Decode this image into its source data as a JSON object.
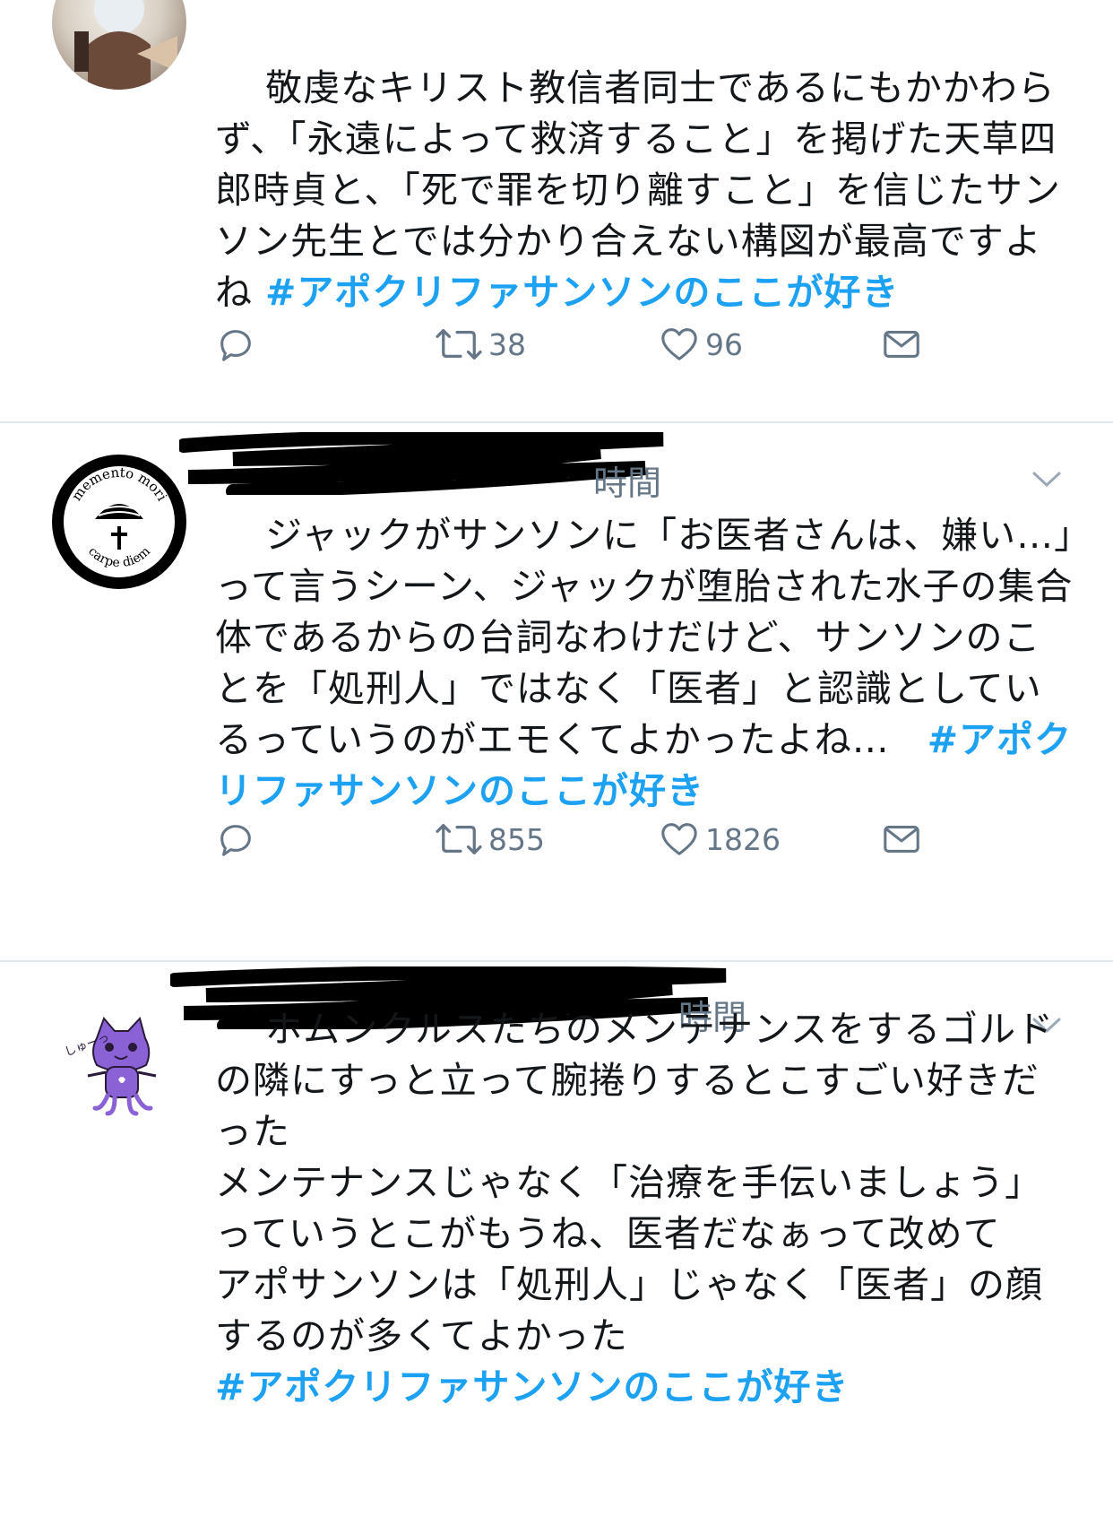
{
  "tweets": [
    {
      "text": "敬虔なキリスト教信者同士であるにもかかわらず、「永遠によって救済すること」を掲げた天草四郎時貞と、「死で罪を切り離すこと」を信じたサンソン先生とでは分かり合えない構図が最高ですよね ",
      "hashtag": "#アポクリファサンソンのここが好き",
      "retweets": "38",
      "likes": "96"
    },
    {
      "time_fragment": "時間",
      "avatar_text_top": "memento mori",
      "avatar_text_bottom": "carpe diem",
      "text": "ジャックがサンソンに「お医者さんは、嫌い…」って言うシーン、ジャックが堕胎された水子の集合体であるからの台詞なわけだけど、サンソンのことを「処刑人」ではなく「医者」と認識としているっていうのがエモくてよかったよね…　",
      "hashtag": "#アポクリファサンソンのここが好き",
      "retweets": "855",
      "likes": "1826"
    },
    {
      "time_fragment": "時間",
      "avatar_text": "しゅーっ",
      "text": "ホムンクルスたちのメンテナンスをするゴルドの隣にすっと立って腕捲りするとこすごい好きだった\nメンテナンスじゃなく「治療を手伝いましょう」っていうとこがもうね、医者だなぁって改めて\nアポサンソンは「処刑人」じゃなく「医者」の顔するのが多くてよかった\n",
      "hashtag": "#アポクリファサンソンのここが好き"
    }
  ],
  "colors": {
    "hashtag": "#1da1f2",
    "icon": "#657786",
    "divider": "#e1e8ed",
    "text": "#14171a"
  },
  "icons": [
    "reply-icon",
    "retweet-icon",
    "heart-icon",
    "dm-icon",
    "chevron-down-icon"
  ]
}
